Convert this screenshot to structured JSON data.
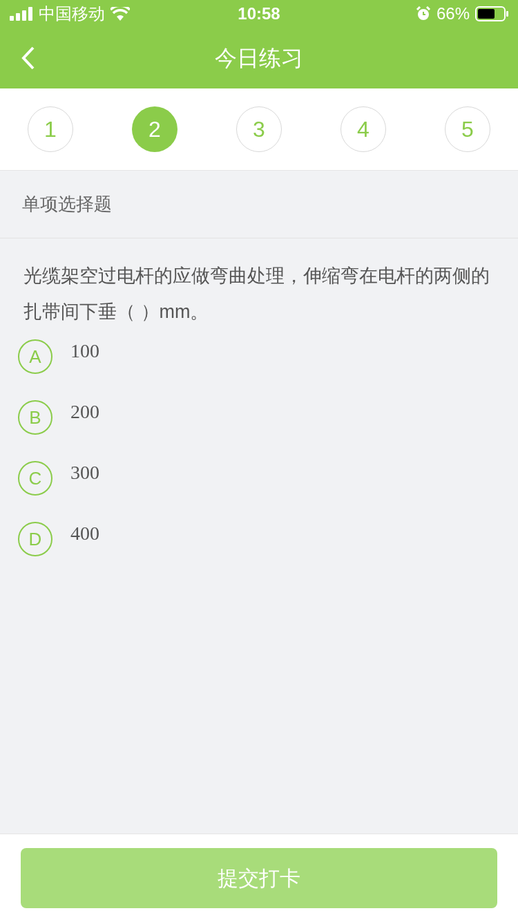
{
  "status_bar": {
    "carrier": "中国移动",
    "time": "10:58",
    "battery": "66%"
  },
  "header": {
    "title": "今日练习"
  },
  "steps": [
    {
      "label": "1",
      "selected": false
    },
    {
      "label": "2",
      "selected": true
    },
    {
      "label": "3",
      "selected": false
    },
    {
      "label": "4",
      "selected": false
    },
    {
      "label": "5",
      "selected": false
    }
  ],
  "section_title": "单项选择题",
  "question": "光缆架空过电杆的应做弯曲处理，伸缩弯在电杆的两侧的扎带间下垂（    ）mm。",
  "options": [
    {
      "letter": "A",
      "text": "100",
      "selected": false
    },
    {
      "letter": "B",
      "text": "200",
      "selected": false
    },
    {
      "letter": "C",
      "text": "300",
      "selected": false
    },
    {
      "letter": "D",
      "text": "400",
      "selected": false
    }
  ],
  "submit_button": "提交打卡"
}
